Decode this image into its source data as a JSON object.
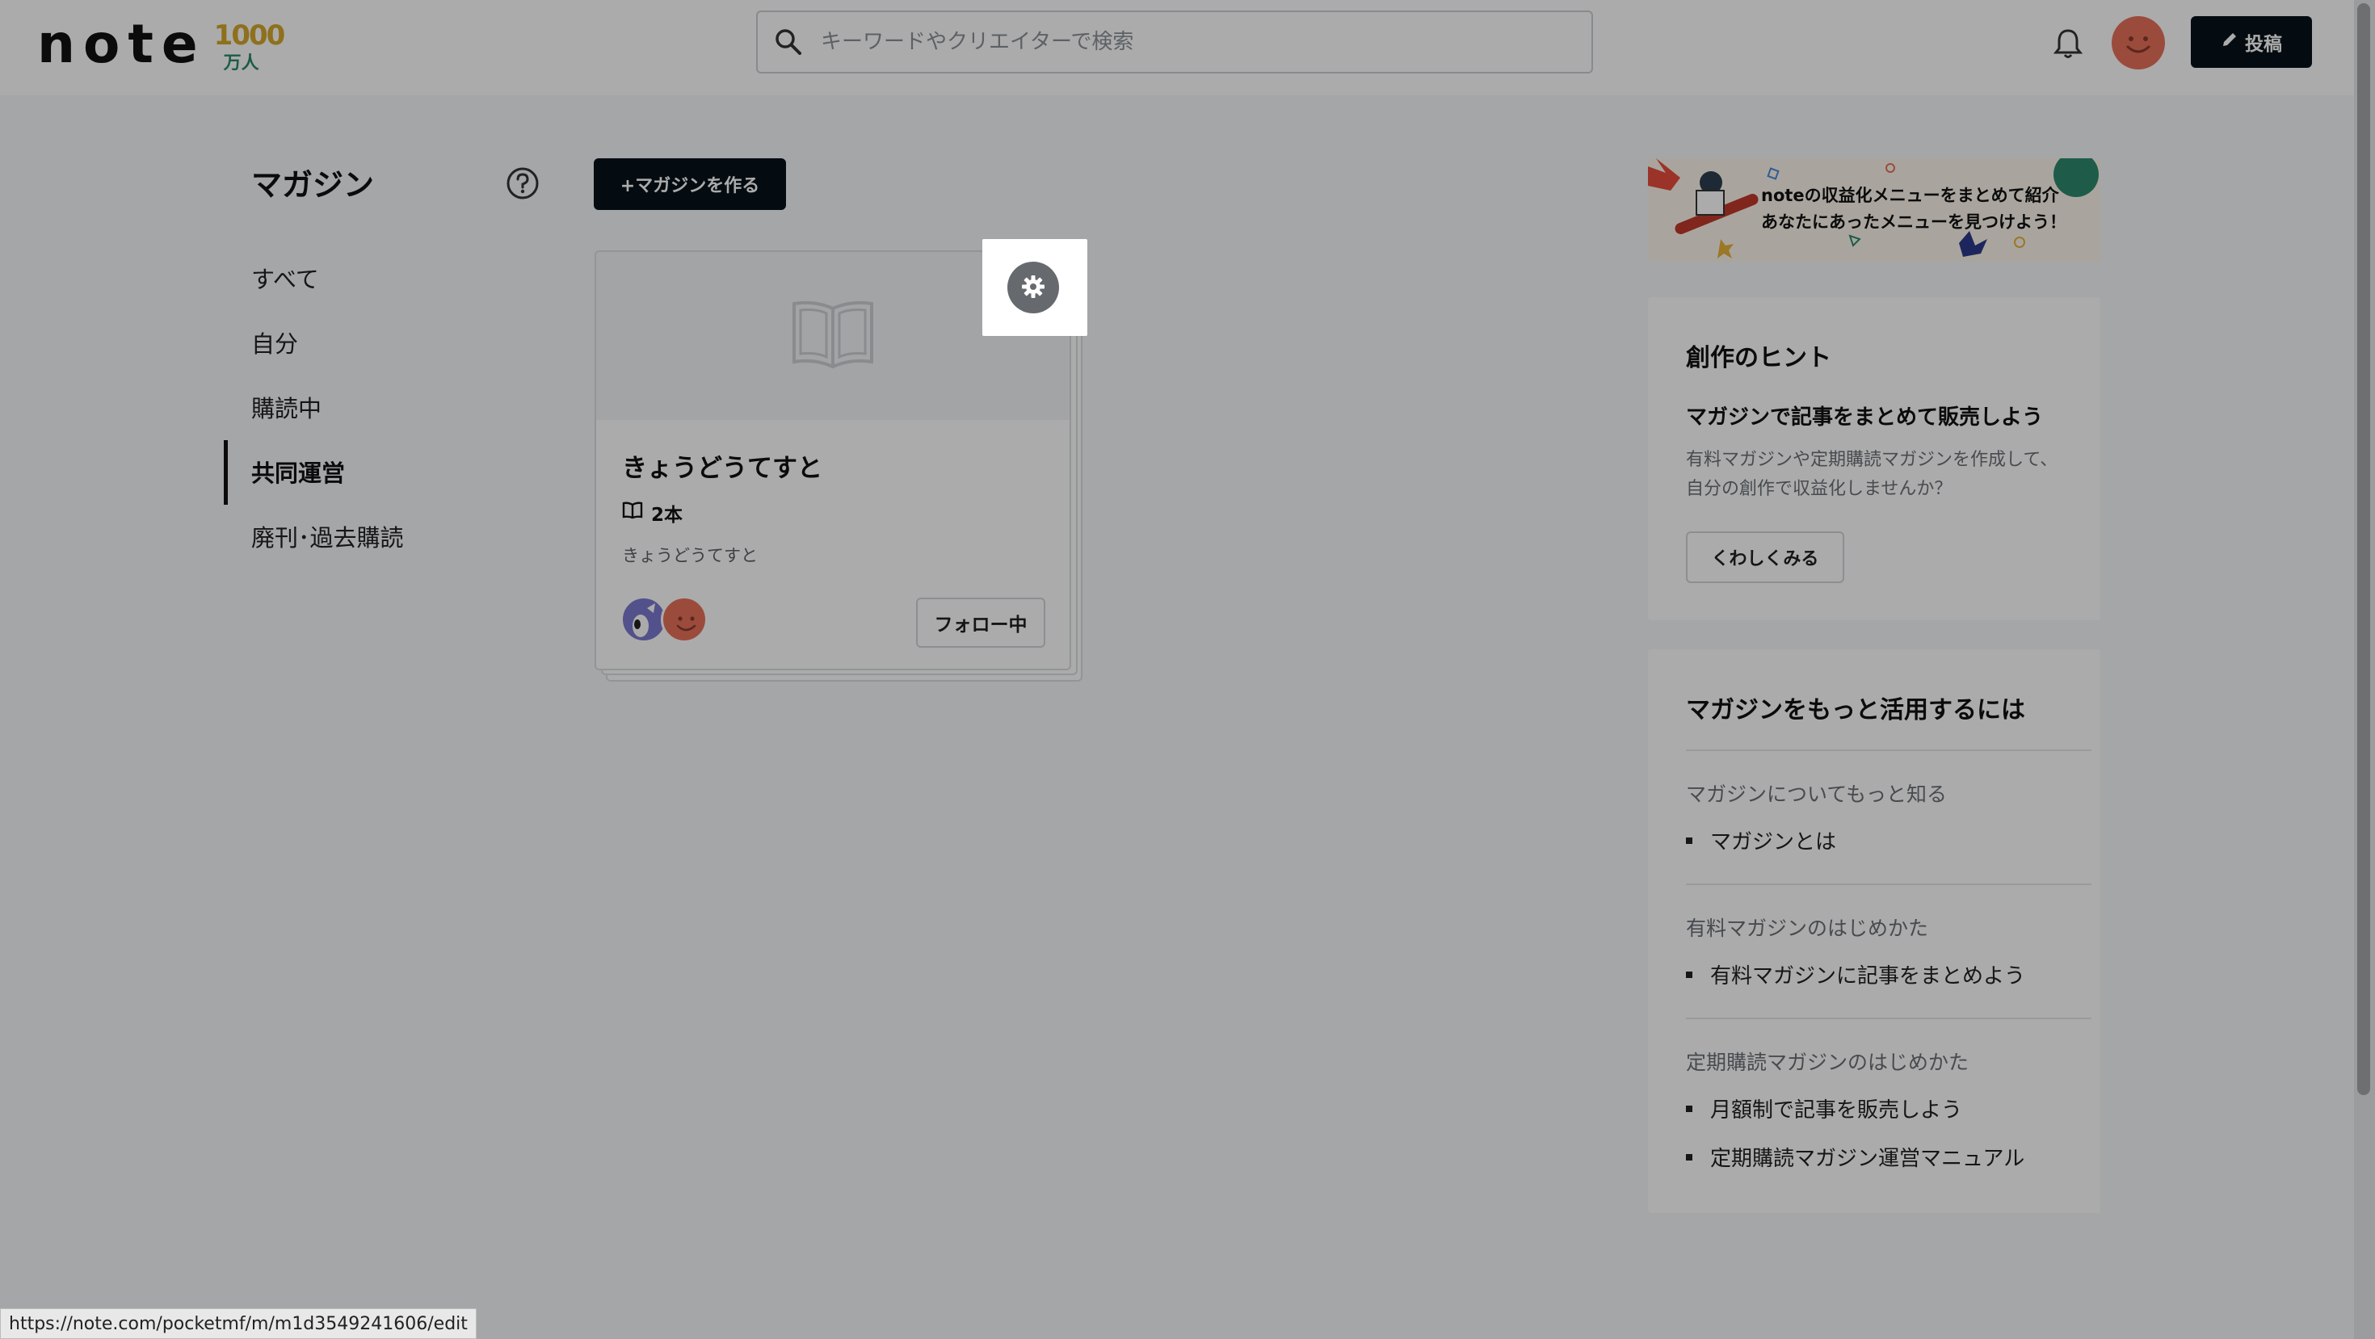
{
  "header": {
    "logo_text": "note",
    "logo_badge_number": "1000",
    "logo_badge_unit": "万人",
    "search_placeholder": "キーワードやクリエイターで検索",
    "post_label": "投稿"
  },
  "nav": {
    "title": "マガジン",
    "items": [
      {
        "label": "すべて",
        "active": false
      },
      {
        "label": "自分",
        "active": false
      },
      {
        "label": "購読中",
        "active": false
      },
      {
        "label": "共同運営",
        "active": true
      },
      {
        "label": "廃刊･過去購読",
        "active": false
      }
    ]
  },
  "main": {
    "create_label": "+マガジンを作る",
    "magazine": {
      "title": "きょうどうてすと",
      "count": "2本",
      "description": "きょうどうてすと",
      "follow_label": "フォロー中"
    }
  },
  "sidebar": {
    "banner_line1": "noteの収益化メニューをまとめて紹介",
    "banner_line2": "あなたにあったメニューを見つけよう！",
    "hint": {
      "title": "創作のヒント",
      "subtitle": "マガジンで記事をまとめて販売しよう",
      "body": "有料マガジンや定期購読マガジンを作成して、自分の創作で収益化しませんか？",
      "button_label": "くわしくみる"
    },
    "guide": {
      "title": "マガジンをもっと活用するには",
      "sections": [
        {
          "title": "マガジンについてもっと知る",
          "links": [
            "マガジンとは"
          ]
        },
        {
          "title": "有料マガジンのはじめかた",
          "links": [
            "有料マガジンに記事をまとめよう"
          ]
        },
        {
          "title": "定期購読マガジンのはじめかた",
          "links": [
            "月額制で記事を販売しよう",
            "定期購読マガジン運営マニュアル"
          ]
        }
      ]
    }
  },
  "status_url": "https://note.com/pocketmf/m/m1d3549241606/edit",
  "colors": {
    "brand_dark": "#08131a",
    "avatar_orange": "#e8705a",
    "background": "#f5f8fa"
  },
  "icons": {
    "search": "search-icon",
    "bell": "bell-icon",
    "help": "help-icon",
    "gear": "gear-icon",
    "book": "book-icon",
    "pencil": "pencil-icon"
  }
}
